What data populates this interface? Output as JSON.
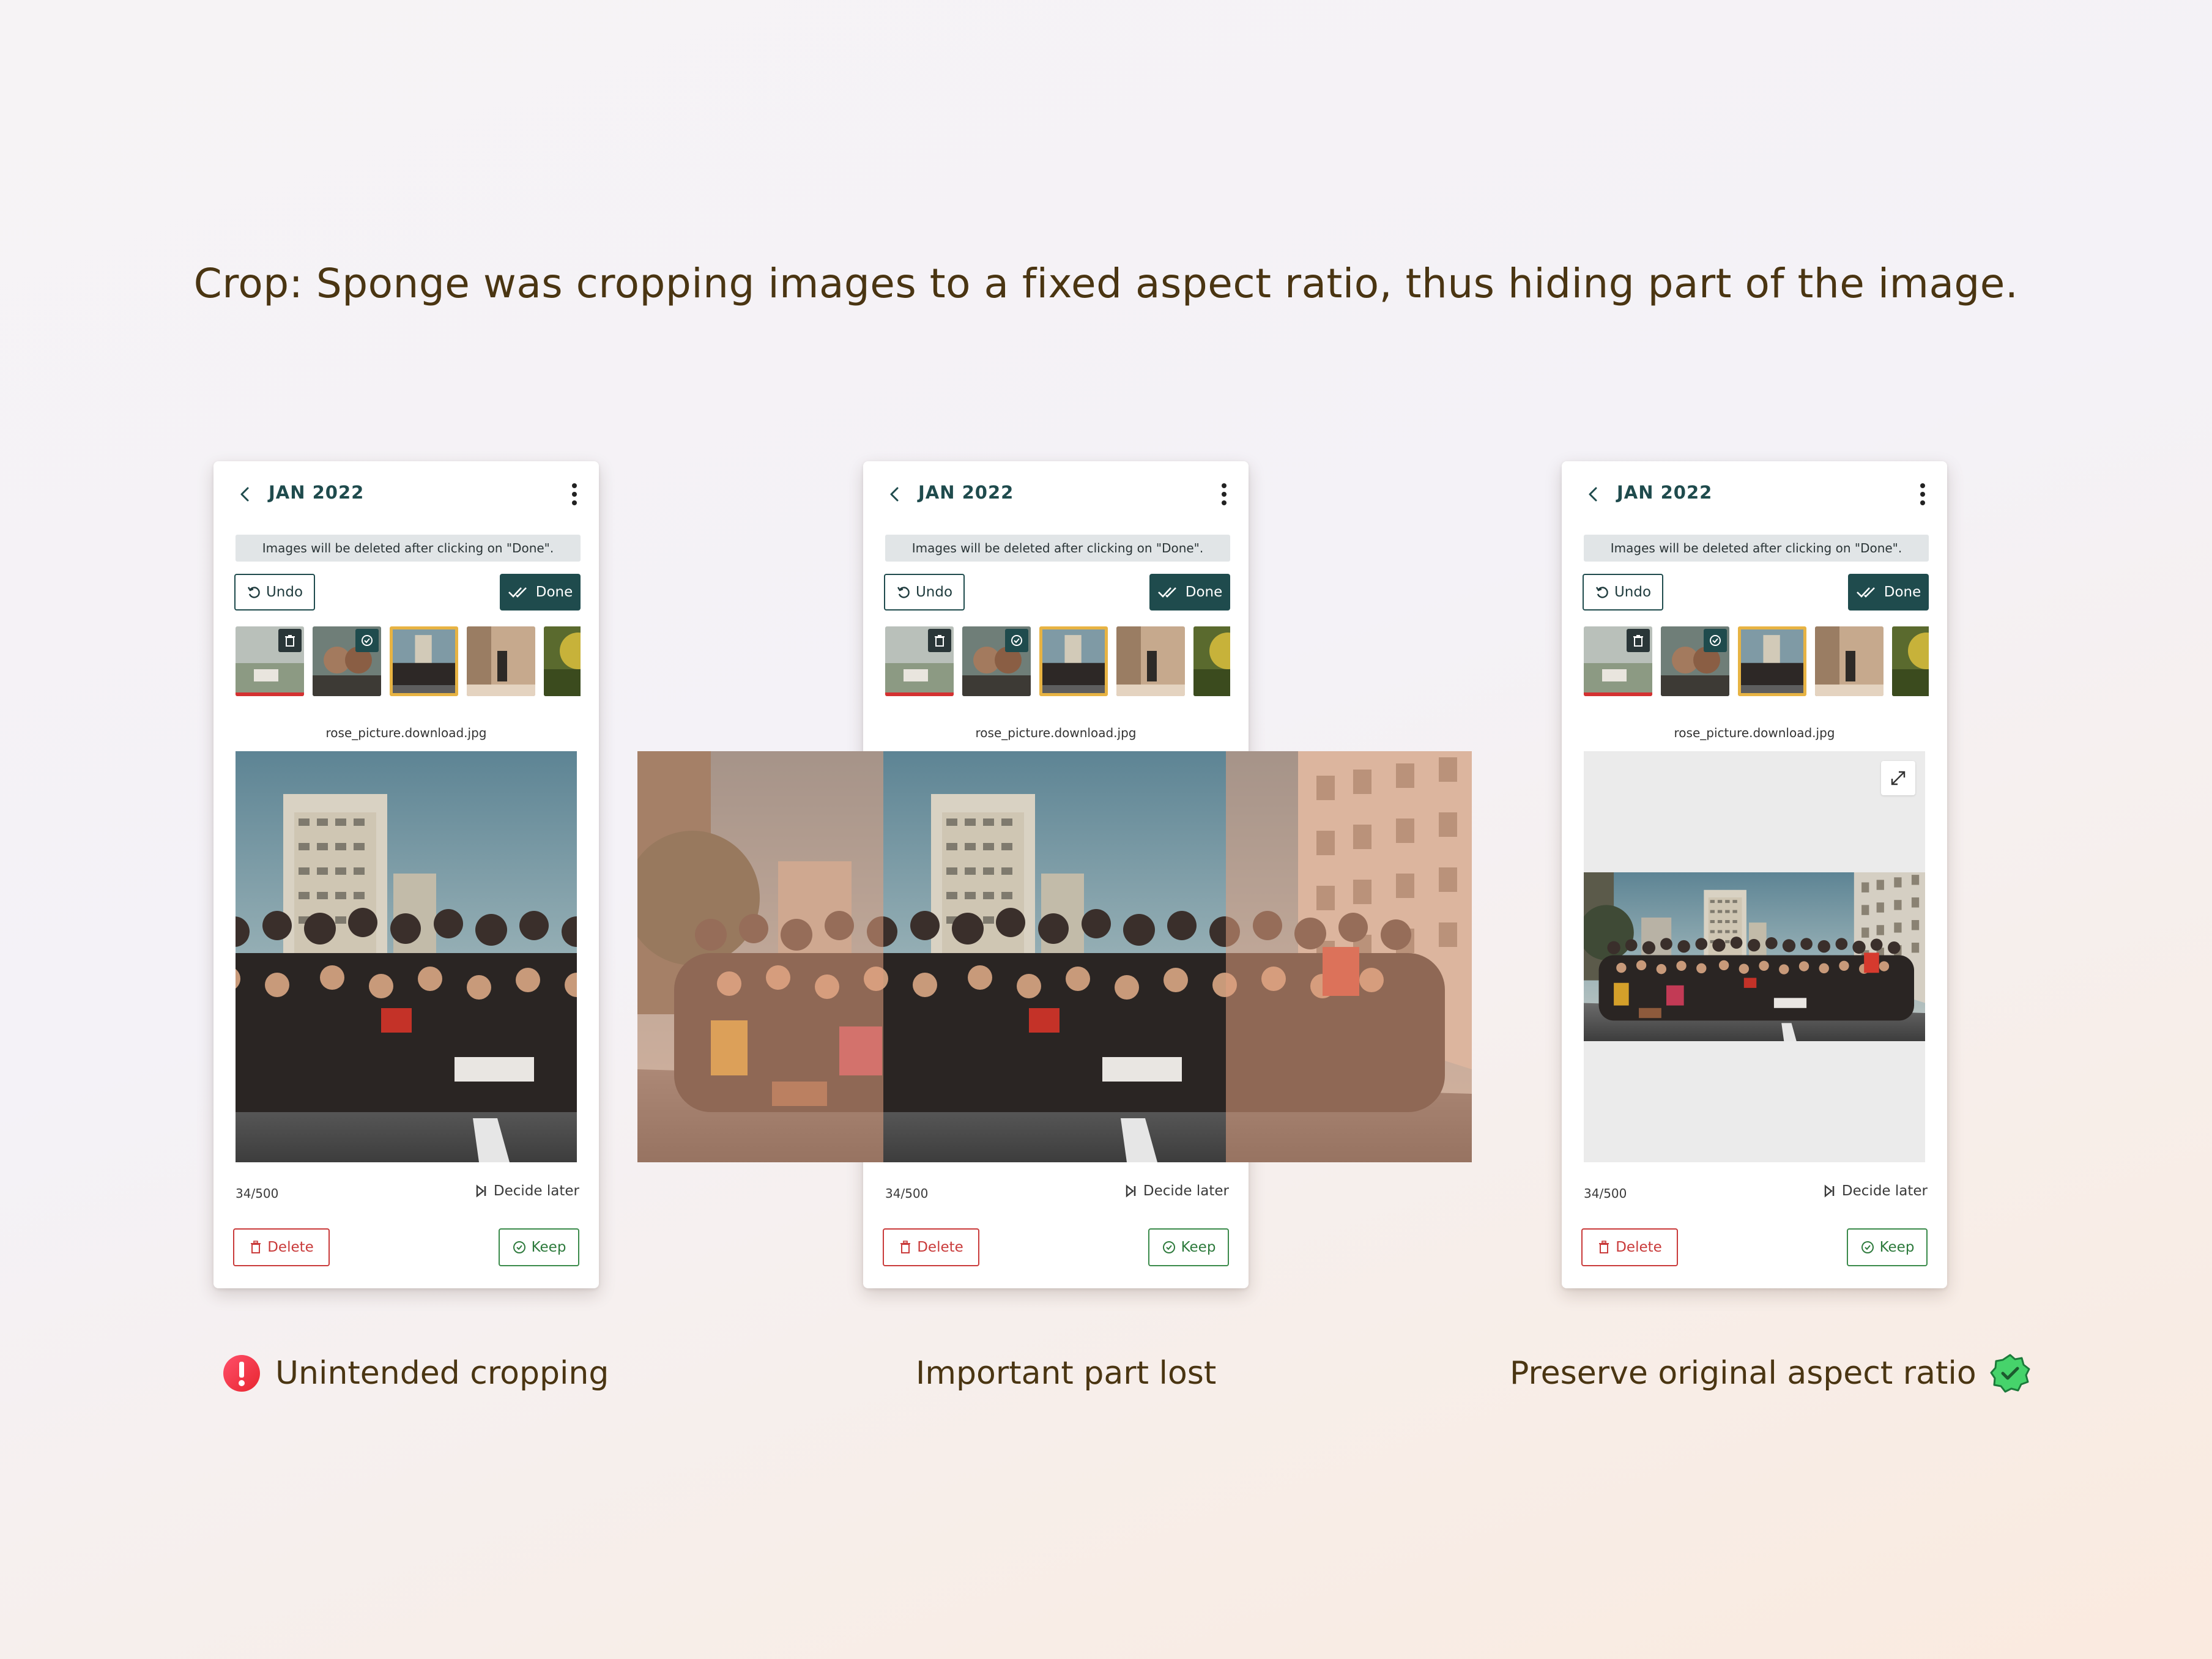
{
  "headline": "Crop: Sponge was cropping images to a fixed aspect ratio, thus hiding part of the image.",
  "screens": [
    {
      "month": "JAN 2022",
      "notice": "Images will be deleted after clicking on \"Done\".",
      "undo_label": "Undo",
      "done_label": "Done",
      "filename": "rose_picture.download.jpg",
      "counter": "34/500",
      "decide_later": "Decide later",
      "delete_label": "Delete",
      "keep_label": "Keep"
    },
    {
      "month": "JAN 2022",
      "notice": "Images will be deleted after clicking on \"Done\".",
      "undo_label": "Undo",
      "done_label": "Done",
      "filename": "rose_picture.download.jpg",
      "counter": "34/500",
      "decide_later": "Decide later",
      "delete_label": "Delete",
      "keep_label": "Keep"
    },
    {
      "month": "JAN 2022",
      "notice": "Images will be deleted after clicking on \"Done\".",
      "undo_label": "Undo",
      "done_label": "Done",
      "filename": "rose_picture.download.jpg",
      "counter": "34/500",
      "decide_later": "Decide later",
      "delete_label": "Delete",
      "keep_label": "Keep"
    }
  ],
  "captions": {
    "left": "Unintended cropping",
    "middle": "Important part lost",
    "right": "Preserve original aspect ratio"
  },
  "icons": {
    "left_status": "alert-icon",
    "right_status": "verified-badge-icon"
  },
  "colors": {
    "brand": "#1f4b4d",
    "danger": "#c93a3a",
    "success": "#2d7a3c",
    "selected_thumb": "#e7b343",
    "caption_text": "#4a3512"
  }
}
